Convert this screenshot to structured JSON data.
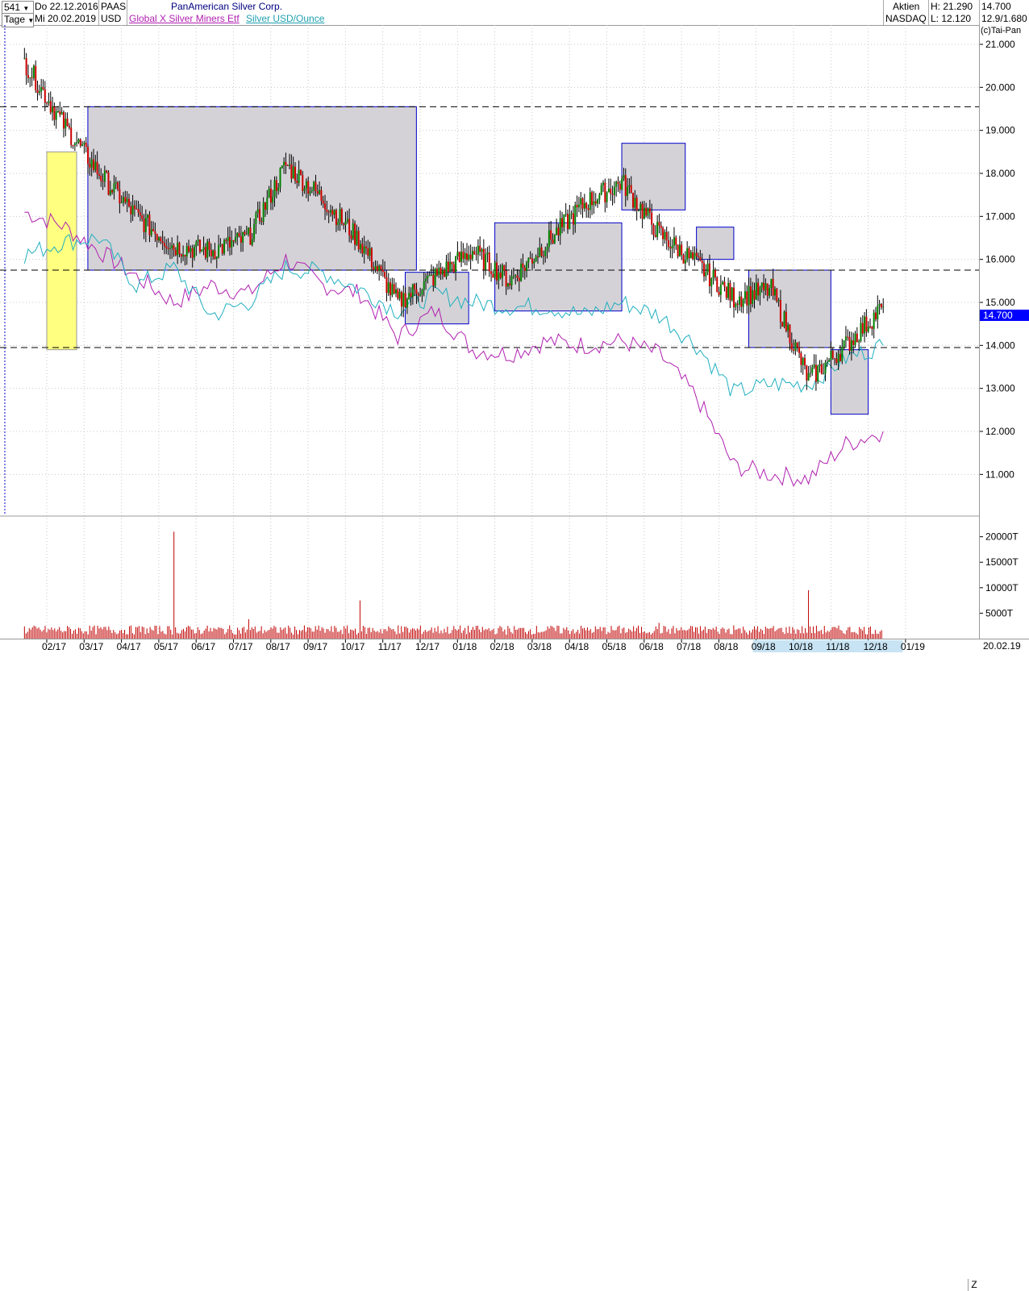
{
  "header": {
    "count_select": "541",
    "period_select": "Tage",
    "start_date": "Do 22.12.2016",
    "end_date": "Mi 20.02.2019",
    "symbol": "PAAS",
    "currency": "USD",
    "title": "PanAmerican Silver Corp.",
    "compare1": "Global X Silver Miners Etf",
    "compare2": "Silver USD/Ounce",
    "market_type": "Aktien",
    "exchange": "NASDAQ",
    "high": "H: 21.290",
    "low": "L: 12.120",
    "last": "14.700",
    "range": "12.9/1.680"
  },
  "colors": {
    "up": "#008000",
    "down": "#cc0000",
    "box_fill": "#d4d2d6",
    "box_border": "#0000cc",
    "highlight": "#ffff80",
    "etf": "#b020b0",
    "silver": "#20b0c0",
    "volume": "#c00000",
    "last_tag": "#0000ff"
  },
  "chart_data": [
    {
      "type": "line",
      "panel": "price",
      "copyright": "(c)Tai-Pan",
      "y_ticks": [
        "21.000",
        "20.000",
        "19.000",
        "18.000",
        "17.000",
        "16.000",
        "15.000",
        "14.000",
        "13.000",
        "12.000",
        "11.000"
      ],
      "ylim": [
        10.2,
        21.3
      ],
      "last_value": "14.700",
      "x": [
        "02.17",
        "03.17",
        "04.17",
        "05.17",
        "06.17",
        "07.17",
        "08.17",
        "09.17",
        "10.17",
        "11.17",
        "12.17",
        "01.18",
        "02.18",
        "03.18",
        "04.18",
        "05.18",
        "06.18",
        "07.18",
        "08.18",
        "09.18",
        "10.18",
        "11.18",
        "12.18",
        "01.19"
      ],
      "series": [
        {
          "name": "PAAS",
          "style": "candlestick",
          "values": [
            20.6,
            19.2,
            18.0,
            17.0,
            16.3,
            16.2,
            16.5,
            18.2,
            17.4,
            16.4,
            15.0,
            15.6,
            16.2,
            15.5,
            16.4,
            17.3,
            17.8,
            16.6,
            15.9,
            15.1,
            15.3,
            13.2,
            14.0,
            14.9
          ]
        },
        {
          "name": "Global X Silver Miners Etf",
          "values": [
            17.1,
            16.8,
            16.2,
            15.6,
            15.0,
            15.4,
            15.2,
            16.0,
            15.4,
            15.2,
            14.2,
            14.8,
            13.9,
            13.8,
            14.1,
            14.0,
            14.1,
            13.8,
            12.8,
            11.2,
            11.0,
            10.9,
            11.7,
            12.0
          ]
        },
        {
          "name": "Silver USD/Ounce",
          "values": [
            16.1,
            16.4,
            16.5,
            15.4,
            15.8,
            14.7,
            15.0,
            15.8,
            15.7,
            15.3,
            14.8,
            15.2,
            15.0,
            14.9,
            14.9,
            14.7,
            15.0,
            14.7,
            14.0,
            12.9,
            13.1,
            13.1,
            13.7,
            14.0
          ]
        }
      ],
      "levels": [
        19.55,
        15.75,
        13.95
      ],
      "boxes": [
        {
          "x0": 0.0,
          "x1": 0.8,
          "y0": 13.9,
          "y1": 18.5,
          "style": "highlight"
        },
        {
          "x0": 1.1,
          "x1": 9.9,
          "y0": 15.75,
          "y1": 19.55,
          "style": "range"
        },
        {
          "x0": 9.6,
          "x1": 11.3,
          "y0": 14.5,
          "y1": 15.7,
          "style": "range"
        },
        {
          "x0": 12.0,
          "x1": 15.4,
          "y0": 14.8,
          "y1": 16.85,
          "style": "range"
        },
        {
          "x0": 15.4,
          "x1": 17.1,
          "y0": 17.15,
          "y1": 18.7,
          "style": "range"
        },
        {
          "x0": 17.4,
          "x1": 18.4,
          "y0": 16.0,
          "y1": 16.75,
          "style": "range"
        },
        {
          "x0": 18.8,
          "x1": 21.0,
          "y0": 13.95,
          "y1": 15.75,
          "style": "range"
        },
        {
          "x0": 21.0,
          "x1": 22.0,
          "y0": 12.4,
          "y1": 13.9,
          "style": "range"
        }
      ]
    },
    {
      "type": "bar",
      "panel": "volume",
      "y_ticks": [
        "20000T",
        "15000T",
        "10000T",
        "5000T"
      ],
      "ylim": [
        0,
        22000
      ],
      "x": [
        "02.17",
        "03.17",
        "04.17",
        "05.17",
        "06.17",
        "07.17",
        "08.17",
        "09.17",
        "10.17",
        "11.17",
        "12.17",
        "01.18",
        "02.18",
        "03.18",
        "04.18",
        "05.18",
        "06.18",
        "07.18",
        "08.18",
        "09.18",
        "10.18",
        "11.18",
        "12.18",
        "01.19"
      ],
      "values": [
        2400,
        2200,
        2000,
        2300,
        21000,
        2100,
        3800,
        2200,
        2000,
        7500,
        2600,
        2100,
        2300,
        2000,
        2400,
        2100,
        2000,
        3100,
        2200,
        2600,
        2100,
        9500,
        2600,
        5800
      ]
    }
  ],
  "xaxis": {
    "labels": [
      "02/17",
      "03/17",
      "04/17",
      "05/17",
      "06/17",
      "07/17",
      "08/17",
      "09/17",
      "10/17",
      "11/17",
      "12/17",
      "01/18",
      "02/18",
      "03/18",
      "04/18",
      "05/18",
      "06/18",
      "07/18",
      "08/18",
      "09/18",
      "10/18",
      "11/18",
      "12/18",
      "01/19"
    ],
    "end_label": "20.02.19",
    "corner": "Z"
  }
}
